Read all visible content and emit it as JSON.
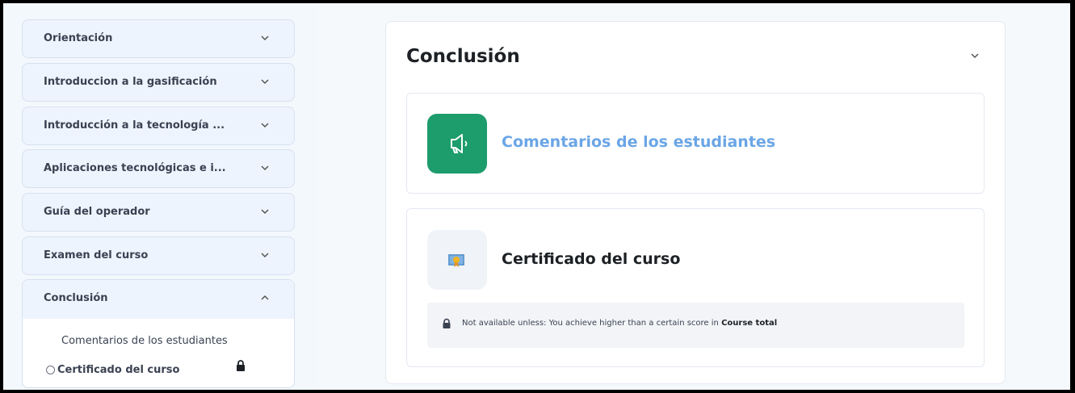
{
  "sidebar": {
    "sections": [
      {
        "label": "Orientación",
        "expanded": false
      },
      {
        "label": "Introduccion a la gasificación",
        "expanded": false
      },
      {
        "label": "Introducción a la tecnología ...",
        "expanded": false
      },
      {
        "label": "Aplicaciones tecnológicas e i...",
        "expanded": false
      },
      {
        "label": "Guía del operador",
        "expanded": false
      },
      {
        "label": "Examen del curso",
        "expanded": false
      },
      {
        "label": "Conclusión",
        "expanded": true
      }
    ],
    "conclusion_items": [
      {
        "label": "Comentarios de los estudiantes"
      },
      {
        "label": "Certificado del curso",
        "locked": true
      }
    ]
  },
  "main": {
    "section_title": "Conclusión",
    "activities": [
      {
        "name": "Comentarios de los estudiantes",
        "icon": "megaphone-icon",
        "color": "#1d9c6c"
      },
      {
        "name": "Certificado del curso",
        "icon": "certificate-icon",
        "restriction": {
          "prefix": "Not available unless: You achieve higher than a certain score in ",
          "bold": "Course total"
        }
      }
    ]
  }
}
